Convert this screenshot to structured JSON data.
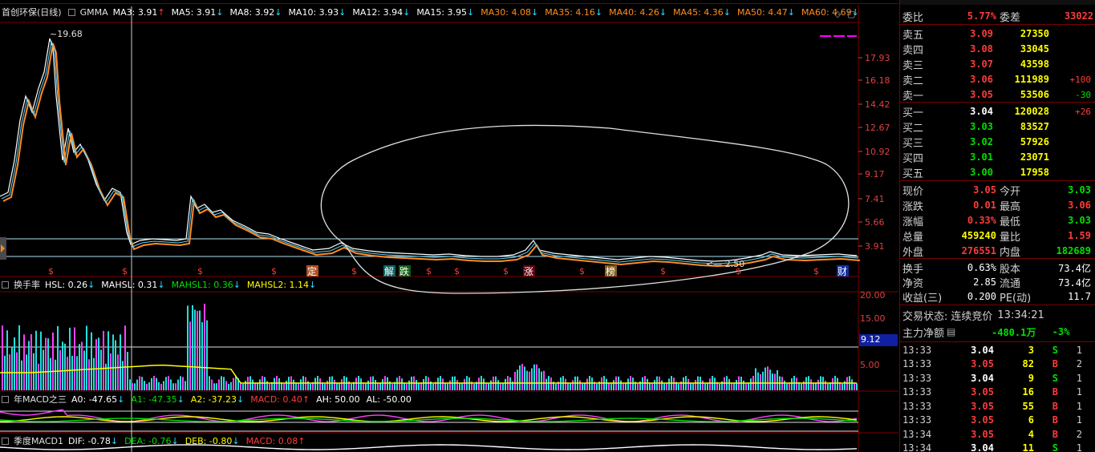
{
  "main_indicator": {
    "stock_name": "首创环保(日线)",
    "indicator": "GMMA",
    "items": [
      {
        "label": "MA3: 3.91",
        "dir": "up",
        "color": "#ffffff"
      },
      {
        "label": "MA5: 3.91",
        "dir": "dn",
        "color": "#ffffff"
      },
      {
        "label": "MA8: 3.92",
        "dir": "dn",
        "color": "#ffffff"
      },
      {
        "label": "MA10: 3.93",
        "dir": "dn",
        "color": "#ffffff"
      },
      {
        "label": "MA12: 3.94",
        "dir": "dn",
        "color": "#ffffff"
      },
      {
        "label": "MA15: 3.95",
        "dir": "dn",
        "color": "#ffffff"
      },
      {
        "label": "MA30: 4.08",
        "dir": "dn",
        "color": "#ff8c20"
      },
      {
        "label": "MA35: 4.16",
        "dir": "dn",
        "color": "#ff8c20"
      },
      {
        "label": "MA40: 4.26",
        "dir": "dn",
        "color": "#ff8c20"
      },
      {
        "label": "MA45: 4.36",
        "dir": "dn",
        "color": "#ff8c20"
      },
      {
        "label": "MA50: 4.47",
        "dir": "dn",
        "color": "#ff8c20"
      },
      {
        "label": "MA60: 4.69",
        "dir": "dn",
        "color": "#ff8c20"
      }
    ],
    "high_label": "19.68",
    "low_label": "2.50"
  },
  "price_axis": [
    "17.93",
    "16.18",
    "14.42",
    "12.67",
    "10.92",
    "9.17",
    "7.41",
    "5.66",
    "3.91"
  ],
  "event_markers": [
    "定",
    "解",
    "跌",
    "涨",
    "榜",
    "财"
  ],
  "turnover_indicator": {
    "name": "换手率",
    "items": [
      {
        "label": "HSL: 0.26",
        "dir": "dn",
        "color": "#ffffff"
      },
      {
        "label": "MAHSL: 0.31",
        "dir": "dn",
        "color": "#ffffff"
      },
      {
        "label": "MAHSL1: 0.36",
        "dir": "dn",
        "color": "#00e000"
      },
      {
        "label": "MAHSL2: 1.14",
        "dir": "dn",
        "color": "#ffff00"
      }
    ],
    "axis": [
      "20.00",
      "15.00",
      "5.00"
    ],
    "marker": "9.12"
  },
  "annual_macd": {
    "name": "年MACD之三",
    "items": [
      {
        "label": "A0: -47.65",
        "dir": "dn",
        "color": "#ffffff"
      },
      {
        "label": "A1: -47.35",
        "dir": "dn",
        "color": "#00e000"
      },
      {
        "label": "A2: -37.23",
        "dir": "dn",
        "color": "#ffff00"
      },
      {
        "label": "MACD: 0.40",
        "dir": "up",
        "color": "#ff3b3b"
      },
      {
        "label": "AH: 50.00",
        "dir": "",
        "color": "#ffffff"
      },
      {
        "label": "AL: -50.00",
        "dir": "",
        "color": "#ffffff"
      }
    ]
  },
  "quarter_macd": {
    "name": "季度MACD1",
    "items": [
      {
        "label": "DIF: -0.78",
        "dir": "dn",
        "color": "#ffffff"
      },
      {
        "label": "DEA: -0.76",
        "dir": "dn",
        "color": "#00e000"
      },
      {
        "label": "DEB: -0.80",
        "dir": "dn",
        "color": "#ffff00"
      },
      {
        "label": "MACD: 0.08",
        "dir": "up",
        "color": "#ff3b3b"
      }
    ]
  },
  "order_book": {
    "header_left": "委比",
    "header_left_value": "5.77%",
    "header_right": "委差",
    "header_right_value": "33022",
    "asks": [
      {
        "label": "卖五",
        "price": "3.09",
        "volume": "27350",
        "change": ""
      },
      {
        "label": "卖四",
        "price": "3.08",
        "volume": "33045",
        "change": ""
      },
      {
        "label": "卖三",
        "price": "3.07",
        "volume": "43598",
        "change": ""
      },
      {
        "label": "卖二",
        "price": "3.06",
        "volume": "111989",
        "change": "+100"
      },
      {
        "label": "卖一",
        "price": "3.05",
        "volume": "53506",
        "change": "-30"
      }
    ],
    "bids": [
      {
        "label": "买一",
        "price": "3.04",
        "volume": "120028",
        "change": "+26"
      },
      {
        "label": "买二",
        "price": "3.03",
        "volume": "83527",
        "change": ""
      },
      {
        "label": "买三",
        "price": "3.02",
        "volume": "57926",
        "change": ""
      },
      {
        "label": "买四",
        "price": "3.01",
        "volume": "23071",
        "change": ""
      },
      {
        "label": "买五",
        "price": "3.00",
        "volume": "17958",
        "change": ""
      }
    ]
  },
  "quote": [
    {
      "l1": "现价",
      "v1": "3.05",
      "c1": "red",
      "l2": "今开",
      "v2": "3.03",
      "c2": "green"
    },
    {
      "l1": "涨跌",
      "v1": "0.01",
      "c1": "red",
      "l2": "最高",
      "v2": "3.06",
      "c2": "red"
    },
    {
      "l1": "涨幅",
      "v1": "0.33%",
      "c1": "red",
      "l2": "最低",
      "v2": "3.03",
      "c2": "green"
    },
    {
      "l1": "总量",
      "v1": "459240",
      "c1": "yellow",
      "l2": "量比",
      "v2": "1.59",
      "c2": "red"
    },
    {
      "l1": "外盘",
      "v1": "276551",
      "c1": "red",
      "l2": "内盘",
      "v2": "182689",
      "c2": "green"
    }
  ],
  "fundamentals": [
    {
      "l1": "换手",
      "v1": "0.63%",
      "l2": "股本",
      "v2": "73.4亿"
    },
    {
      "l1": "净资",
      "v1": "2.85",
      "l2": "流通",
      "v2": "73.4亿"
    },
    {
      "l1": "收益(三)",
      "v1": "0.200",
      "l2": "PE(动)",
      "v2": "11.7"
    }
  ],
  "status": {
    "label": "交易状态:",
    "value": "连续竞价",
    "time": "13:34:21"
  },
  "main_force": {
    "label": "主力净额",
    "value": "-480.1万",
    "pct": "-3%"
  },
  "trades": [
    {
      "time": "13:33",
      "price": "3.04",
      "pc": "white",
      "vol": "3",
      "side": "S",
      "count": "1"
    },
    {
      "time": "13:33",
      "price": "3.05",
      "pc": "red",
      "vol": "82",
      "side": "B",
      "count": "2"
    },
    {
      "time": "13:33",
      "price": "3.04",
      "pc": "white",
      "vol": "9",
      "side": "S",
      "count": "1"
    },
    {
      "time": "13:33",
      "price": "3.05",
      "pc": "red",
      "vol": "16",
      "side": "B",
      "count": "1"
    },
    {
      "time": "13:33",
      "price": "3.05",
      "pc": "red",
      "vol": "55",
      "side": "B",
      "count": "1"
    },
    {
      "time": "13:33",
      "price": "3.05",
      "pc": "red",
      "vol": "6",
      "side": "B",
      "count": "1"
    },
    {
      "time": "13:34",
      "price": "3.05",
      "pc": "red",
      "vol": "4",
      "side": "B",
      "count": "2"
    },
    {
      "time": "13:34",
      "price": "3.04",
      "pc": "white",
      "vol": "11",
      "side": "S",
      "count": "1"
    }
  ],
  "colors": {
    "up": "#ff3b3b",
    "down": "#34d8ff",
    "grid": "#7a0000",
    "ma_short": "#ffffff",
    "ma_long": "#ff8c20"
  }
}
